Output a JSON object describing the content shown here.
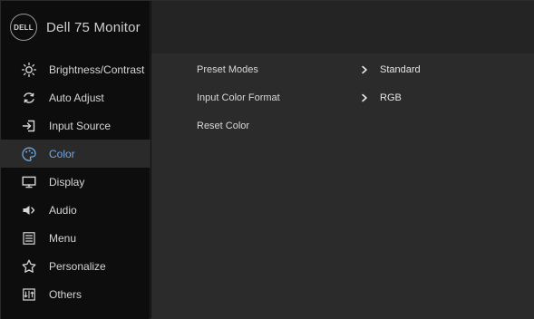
{
  "brand": {
    "logo_text": "DELL",
    "title": "Dell 75 Monitor"
  },
  "menu": [
    {
      "label": "Brightness/Contrast",
      "icon": "brightness-icon",
      "active": false
    },
    {
      "label": "Auto Adjust",
      "icon": "auto-adjust-icon",
      "active": false
    },
    {
      "label": "Input Source",
      "icon": "input-source-icon",
      "active": false
    },
    {
      "label": "Color",
      "icon": "color-icon",
      "active": true
    },
    {
      "label": "Display",
      "icon": "display-icon",
      "active": false
    },
    {
      "label": "Audio",
      "icon": "audio-icon",
      "active": false
    },
    {
      "label": "Menu",
      "icon": "menu-icon",
      "active": false
    },
    {
      "label": "Personalize",
      "icon": "star-icon",
      "active": false
    },
    {
      "label": "Others",
      "icon": "others-icon",
      "active": false
    }
  ],
  "color_settings": [
    {
      "label": "Preset Modes",
      "value": "Standard"
    },
    {
      "label": "Input Color Format",
      "value": "RGB"
    },
    {
      "label": "Reset Color",
      "value": ""
    }
  ],
  "theme": {
    "accent": "#6fa8e6",
    "sidebar_bg": "#0d0d0d",
    "panel_bg": "#2b2b2b",
    "header_bg": "#242424"
  }
}
